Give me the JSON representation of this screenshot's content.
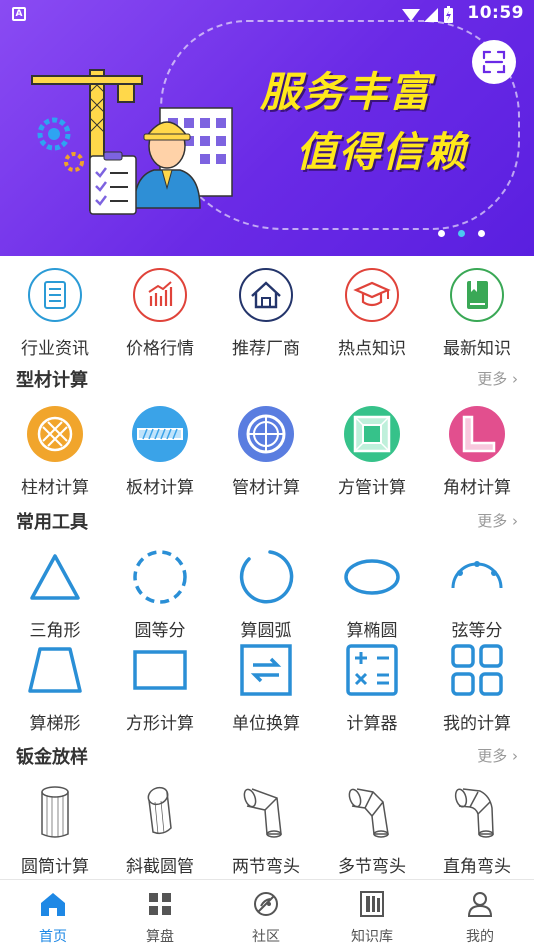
{
  "status_bar": {
    "time": "10:59"
  },
  "banner": {
    "line1": "服务丰富",
    "line2": "值得信赖"
  },
  "quick_links": [
    {
      "label": "行业资讯",
      "icon": "news-list-icon",
      "color": "#2b9bd6"
    },
    {
      "label": "价格行情",
      "icon": "price-chart-icon",
      "color": "#e0433a"
    },
    {
      "label": "推荐厂商",
      "icon": "house-icon",
      "color": "#24356b"
    },
    {
      "label": "热点知识",
      "icon": "graduation-cap-icon",
      "color": "#e0433a"
    },
    {
      "label": "最新知识",
      "icon": "book-icon",
      "color": "#3aa856"
    }
  ],
  "profile_calc": {
    "title": "型材计算",
    "more": "更多",
    "items": [
      {
        "label": "柱材计算",
        "icon": "column-material-icon",
        "color": "#f1a52c"
      },
      {
        "label": "板材计算",
        "icon": "plate-material-icon",
        "color": "#3aa3e8"
      },
      {
        "label": "管材计算",
        "icon": "pipe-material-icon",
        "color": "#5a7de0"
      },
      {
        "label": "方管计算",
        "icon": "square-tube-icon",
        "color": "#36c28a"
      },
      {
        "label": "角材计算",
        "icon": "angle-steel-icon",
        "color": "#e24f8e"
      }
    ]
  },
  "common_tools": {
    "title": "常用工具",
    "more": "更多",
    "items": [
      {
        "label": "三角形",
        "icon": "triangle-icon"
      },
      {
        "label": "圆等分",
        "icon": "dashed-circle-icon"
      },
      {
        "label": "算圆弧",
        "icon": "arc-icon"
      },
      {
        "label": "算椭圆",
        "icon": "ellipse-icon"
      },
      {
        "label": "弦等分",
        "icon": "chord-icon"
      },
      {
        "label": "算梯形",
        "icon": "trapezoid-icon"
      },
      {
        "label": "方形计算",
        "icon": "rectangle-icon"
      },
      {
        "label": "单位换算",
        "icon": "swap-icon"
      },
      {
        "label": "计算器",
        "icon": "calculator-icon"
      },
      {
        "label": "我的计算",
        "icon": "grid-icon"
      }
    ]
  },
  "sheet_metal": {
    "title": "钣金放样",
    "more": "更多",
    "items": [
      {
        "label": "圆筒计算",
        "icon": "cylinder-icon"
      },
      {
        "label": "斜截圆管",
        "icon": "oblique-pipe-icon"
      },
      {
        "label": "两节弯头",
        "icon": "two-section-elbow-icon"
      },
      {
        "label": "多节弯头",
        "icon": "multi-section-elbow-icon"
      },
      {
        "label": "直角弯头",
        "icon": "right-angle-elbow-icon"
      }
    ]
  },
  "tabbar": [
    {
      "label": "首页",
      "icon": "home-icon",
      "active": true
    },
    {
      "label": "算盘",
      "icon": "apps-icon",
      "active": false
    },
    {
      "label": "社区",
      "icon": "community-icon",
      "active": false
    },
    {
      "label": "知识库",
      "icon": "knowledge-icon",
      "active": false
    },
    {
      "label": "我的",
      "icon": "user-icon",
      "active": false
    }
  ],
  "colors": {
    "accent": "#1e88e5",
    "tool_blue": "#2a8fd6",
    "banner_purple": "#6a2ae6",
    "slogan_yellow": "#ffe81a"
  }
}
